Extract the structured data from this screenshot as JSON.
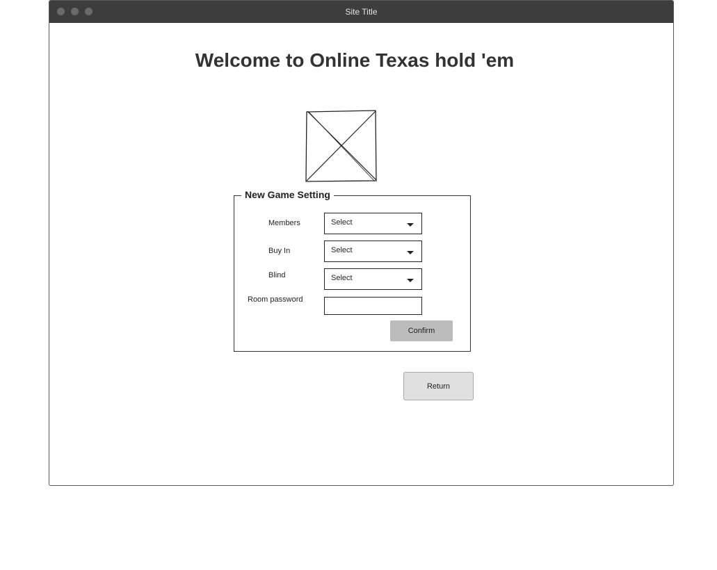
{
  "window": {
    "title": "Site Title"
  },
  "page": {
    "title": "Welcome to Online Texas hold 'em"
  },
  "image": {
    "icon": "image-placeholder-icon"
  },
  "form": {
    "legend": "New Game Setting",
    "members": {
      "label": "Members",
      "value": "Select"
    },
    "buy_in": {
      "label": "Buy In",
      "value": "Select"
    },
    "blind": {
      "label": "Blind",
      "value": "Select"
    },
    "room_password": {
      "label": "Room password",
      "value": ""
    },
    "confirm_label": "Confirm"
  },
  "actions": {
    "return_label": "Return"
  },
  "colors": {
    "titlebar": "#3d3d3d",
    "confirm_button": "#bcbcbc",
    "return_button": "#e0e0e0"
  }
}
